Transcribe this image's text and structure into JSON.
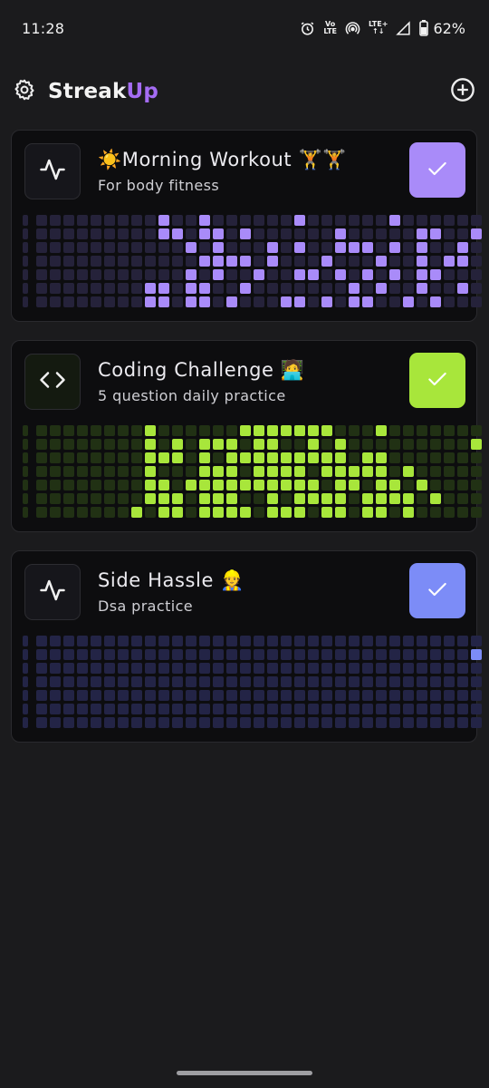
{
  "status_bar": {
    "time": "11:28",
    "network_label": "LTE",
    "volte_label": "Vo",
    "lte_plus_label": "LTE+",
    "battery": "62%",
    "icons": [
      "alarm-icon",
      "volte-icon",
      "hotspot-icon",
      "lte-plus-icon",
      "signal-icon",
      "battery-icon"
    ]
  },
  "header": {
    "title_main": "Streak",
    "title_accent": "Up",
    "accent_color": "#a46cf3",
    "left_icon": "gear-icon",
    "right_icon": "add-circle-icon"
  },
  "habits": [
    {
      "title": "☀️Morning Workout 🏋️🏋️",
      "subtitle": "For body fitness",
      "icon": "activity-icon",
      "color_active": "#a98bf9",
      "color_inactive": "#25223a",
      "check_bg": "#a98bf9",
      "grid": [
        "0000000000100100000010000001000000",
        "0000000000110110100000010000011001",
        "0000000000001010001010011101010010",
        "0000000000000111101000100010010110",
        "0000000000001010010011010101011000",
        "0000000001101100100000001010010010",
        "0000000001101101000110101100101000"
      ]
    },
    {
      "title": "Coding Challenge 🧑‍💻",
      "subtitle": "5 question daily practice",
      "icon": "code-icon",
      "color_active": "#a8e63b",
      "color_inactive": "#213114",
      "check_bg": "#a8e63b",
      "grid": [
        "0000000001000000111111100010000000",
        "0000000001010111011001010000000001",
        "0000000001110101111111110110000000",
        "0000000001000111011110111110100000",
        "0000000001101111111111011011010000",
        "0000000001110111001011110111101000",
        "0000000010110111101110110110100000"
      ]
    },
    {
      "title": "Side Hassle 👷",
      "subtitle": "Dsa practice",
      "icon": "activity-icon",
      "color_active": "#7c8cf7",
      "color_inactive": "#232446",
      "check_bg": "#7c8cf7",
      "grid": [
        "0000000000000000000000000000000000",
        "0000000000000000000000000000000001",
        "0000000000000000000000000000000000",
        "0000000000000000000000000000000000",
        "0000000000000000000000000000000000",
        "0000000000000000000000000000000000",
        "0000000000000000000000000000000000"
      ]
    }
  ]
}
